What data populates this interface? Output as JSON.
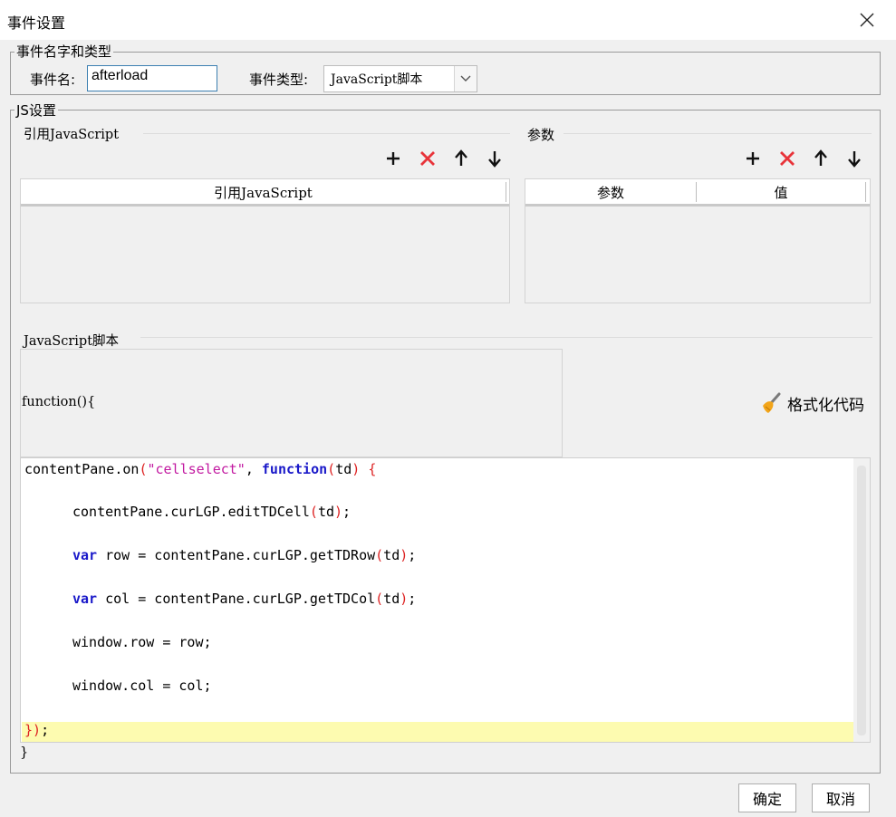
{
  "window": {
    "title": "事件设置"
  },
  "event_group": {
    "legend": "事件名字和类型",
    "name_label": "事件名:",
    "name_value": "afterload",
    "type_label": "事件类型:",
    "type_value": "JavaScript脚本"
  },
  "js_group": {
    "legend": "JS设置",
    "ref_section": {
      "title": "引用JavaScript",
      "column": "引用JavaScript"
    },
    "param_section": {
      "title": "参数",
      "columns": [
        "参数",
        "值"
      ]
    },
    "script_section": {
      "title": "JavaScript脚本",
      "header_text": "function(){",
      "format_label": "格式化代码",
      "footer_text": "}"
    }
  },
  "code_lines": [
    "contentPane.on(\"cellselect\", function(td) {",
    "contentPane.curLGP.editTDCell(td);",
    "var row = contentPane.curLGP.getTDRow(td);",
    "var col = contentPane.curLGP.getTDCol(td);",
    "window.row = row;",
    "window.col = col;",
    "});"
  ],
  "buttons": {
    "ok": "确定",
    "cancel": "取消"
  },
  "icons": {
    "close": "close-icon",
    "add": "plus-icon",
    "delete": "delete-x-icon",
    "up": "arrow-up-icon",
    "down": "arrow-down-icon",
    "dropdown": "chevron-down-icon",
    "format": "broom-icon"
  },
  "colors": {
    "delete": "#e8343a",
    "highlight": "#fdfbb0",
    "keyword": "#1a19c9",
    "string": "#c21aa1",
    "paren": "#dd2222"
  }
}
